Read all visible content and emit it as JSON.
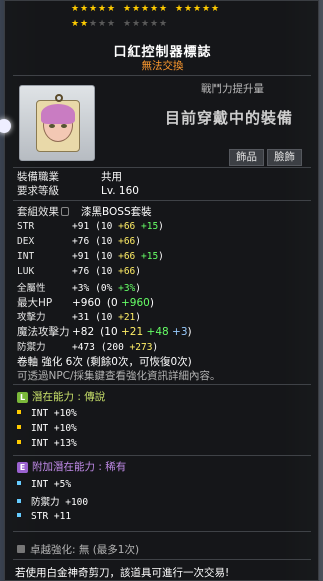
{
  "item": {
    "name": "口紅控制器標誌",
    "trade": "無法交換",
    "ap_label": "戰鬥力提升量",
    "equipped_label": "目前穿戴中的裝備",
    "cat1": "飾品",
    "cat2": "臉飾"
  },
  "stars": {
    "filled": 17,
    "total": 25
  },
  "req": {
    "job_k": "裝備職業",
    "job_v": "共用",
    "lvl_k": "要求等級",
    "lvl_v": "Lv. 160"
  },
  "set": {
    "k": "套組效果",
    "v": "漆黑BOSS套裝"
  },
  "stats": [
    {
      "k": "STR",
      "v": "+91",
      "base": "10",
      "a": "+66",
      "b": "+15",
      "c": ""
    },
    {
      "k": "DEX",
      "v": "+76",
      "base": "10",
      "a": "+66",
      "b": "",
      "c": ""
    },
    {
      "k": "INT",
      "v": "+91",
      "base": "10",
      "a": "+66",
      "b": "+15",
      "c": ""
    },
    {
      "k": "LUK",
      "v": "+76",
      "base": "10",
      "a": "+66",
      "b": "",
      "c": ""
    },
    {
      "k": "全屬性",
      "v": "+3%",
      "base": "0%",
      "a": "",
      "b": "+3%",
      "c": ""
    },
    {
      "k": "最大HP",
      "v": "+960",
      "base": "0",
      "a": "",
      "b": "+960",
      "c": ""
    },
    {
      "k": "攻擊力",
      "v": "+31",
      "base": "10",
      "a": "+21",
      "b": "",
      "c": ""
    },
    {
      "k": "魔法攻擊力",
      "v": "+82",
      "base": "10",
      "a": "+21",
      "b": "+48",
      "c": "+3"
    },
    {
      "k": "防禦力",
      "v": "+473",
      "base": "200",
      "a": "+273",
      "b": "",
      "c": ""
    }
  ],
  "scroll": {
    "text": "卷軸 強化 6次 (剩餘0次，可恢復0次)",
    "info": "可透過NPC/採集鍵查看強化資訊詳細內容。"
  },
  "potential": {
    "badge": "L",
    "label": "潛在能力 : 傳說",
    "lines": [
      "INT +10%",
      "INT +10%",
      "INT +13%"
    ]
  },
  "bonus": {
    "badge": "E",
    "label": "附加潛在能力 : 稀有",
    "lines": [
      "INT +5%",
      "防禦力 +100",
      "STR +11"
    ]
  },
  "exceptional": {
    "label": "卓越強化: 無 (最多1次)"
  },
  "footer": "若使用白金神奇剪刀，該道具可進行一次交易!",
  "colors": {
    "legend": "#c8e06a",
    "epic": "#b277d6",
    "orange": "#ff9a2e",
    "yellow": "#ffee66",
    "green": "#66ff66",
    "blue": "#99ccff"
  }
}
